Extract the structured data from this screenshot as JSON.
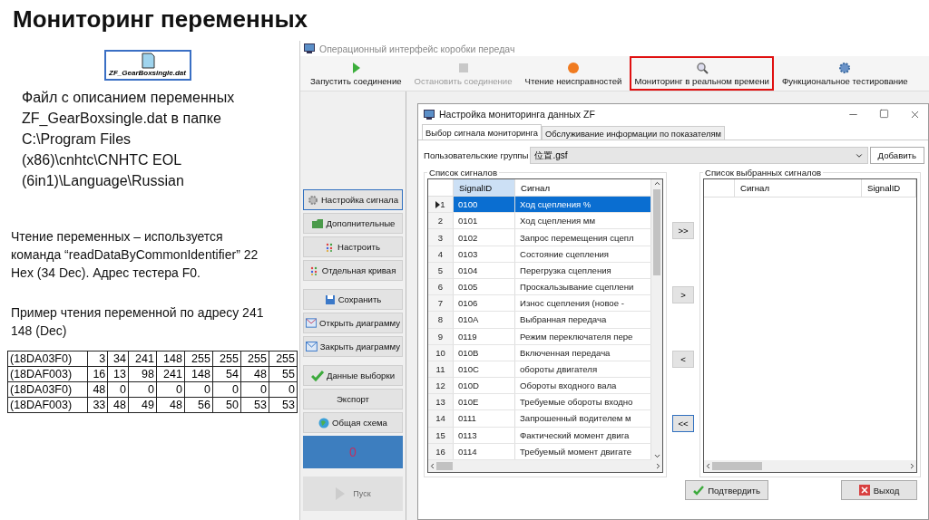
{
  "slide_title": "Мониторинг переменных",
  "file_icon": {
    "label": "ZF_GearBoxsingle.dat"
  },
  "notes": [
    {
      "kind": "large",
      "text": "Файл с описанием переменных ZF_GearBoxsingle.dat в папке C:\\Program Files (x86)\\cnhtc\\CNHTC EOL (6in1)\\Language\\Russian"
    },
    {
      "kind": "small",
      "text": "Чтение переменных – используется команда “readDataByCommonIdentifier” 22 Hex (34 Dec). Адрес тестера F0."
    },
    {
      "kind": "small",
      "text": "Пример чтения переменной по адресу 241 148 (Dec)"
    }
  ],
  "data_table": [
    [
      "(18DA03F0)",
      "3",
      "34",
      "241",
      "148",
      "255",
      "255",
      "255",
      "255"
    ],
    [
      "(18DAF003)",
      "16",
      "13",
      "98",
      "241",
      "148",
      "54",
      "48",
      "55"
    ],
    [
      "(18DA03F0)",
      "48",
      "0",
      "0",
      "0",
      "0",
      "0",
      "0",
      "0"
    ],
    [
      "(18DAF003)",
      "33",
      "48",
      "49",
      "48",
      "56",
      "50",
      "53",
      "53"
    ]
  ],
  "app": {
    "title": "Операционный интерфейс коробки передач",
    "toolbar": [
      {
        "label": "Запустить соединение",
        "disabled": false,
        "highlighted": false
      },
      {
        "label": "Остановить соединение",
        "disabled": true,
        "highlighted": false
      },
      {
        "label": "Чтение неисправностей",
        "disabled": false,
        "highlighted": false
      },
      {
        "label": "Мониторинг в реальном времени",
        "disabled": false,
        "highlighted": true
      },
      {
        "label": "Функциональное тестирование",
        "disabled": false,
        "highlighted": false
      }
    ],
    "side_groups": [
      [
        {
          "label": "Настройка сигнала",
          "focused": true
        },
        {
          "label": "Дополнительные",
          "focused": false
        },
        {
          "label": "Настроить",
          "focused": false
        },
        {
          "label": "Отдельная кривая",
          "focused": false
        }
      ],
      [
        {
          "label": "Сохранить",
          "focused": false
        },
        {
          "label": "Открыть диаграмму",
          "focused": false
        },
        {
          "label": "Закрыть диаграмму",
          "focused": false
        }
      ],
      [
        {
          "label": "Данные выборки",
          "focused": false
        },
        {
          "label": "Экспорт",
          "focused": false
        },
        {
          "label": "Общая схема",
          "focused": false
        }
      ]
    ],
    "counter": "0",
    "run_button": {
      "label": "Пуск",
      "disabled": true
    }
  },
  "dialog": {
    "title": "Настройка мониторинга данных ZF",
    "tabs": [
      {
        "label": "Выбор сигнала мониторинга",
        "selected": true
      },
      {
        "label": "Обслуживание информации по показателям",
        "selected": false
      }
    ],
    "group_label": "Пользовательские группы",
    "group_value": "位置.gsf",
    "add_button": "Добавить",
    "signal_list": {
      "title": "Список сигналов",
      "columns": [
        "SignalID",
        "Сигнал"
      ],
      "rows": [
        {
          "num": "1",
          "id": "0100",
          "signal": "Ход сцепления %",
          "selected": true
        },
        {
          "num": "2",
          "id": "0101",
          "signal": "Ход сцепления мм",
          "selected": false
        },
        {
          "num": "3",
          "id": "0102",
          "signal": "Запрос перемещения сцепл",
          "selected": false
        },
        {
          "num": "4",
          "id": "0103",
          "signal": "Состояние сцепления",
          "selected": false
        },
        {
          "num": "5",
          "id": "0104",
          "signal": "Перегрузка сцепления",
          "selected": false
        },
        {
          "num": "6",
          "id": "0105",
          "signal": "Проскальзывание сцеплени",
          "selected": false
        },
        {
          "num": "7",
          "id": "0106",
          "signal": "Износ сцепления (новое -",
          "selected": false
        },
        {
          "num": "8",
          "id": "010A",
          "signal": "Выбранная передача",
          "selected": false
        },
        {
          "num": "9",
          "id": "0119",
          "signal": "Режим переключателя пере",
          "selected": false
        },
        {
          "num": "10",
          "id": "010B",
          "signal": "Включенная передача",
          "selected": false
        },
        {
          "num": "11",
          "id": "010C",
          "signal": "обороты двигателя",
          "selected": false
        },
        {
          "num": "12",
          "id": "010D",
          "signal": "Обороты входного вала",
          "selected": false
        },
        {
          "num": "13",
          "id": "010E",
          "signal": "Требуемые обороты входно",
          "selected": false
        },
        {
          "num": "14",
          "id": "0111",
          "signal": "Запрошенный водителем м",
          "selected": false
        },
        {
          "num": "15",
          "id": "0113",
          "signal": "Фактический момент двига",
          "selected": false
        },
        {
          "num": "16",
          "id": "0114",
          "signal": "Требуемый момент двигате",
          "selected": false
        }
      ]
    },
    "move_buttons": [
      {
        "label": ">>",
        "focused": false
      },
      {
        "label": ">",
        "focused": false
      },
      {
        "label": "<",
        "focused": false
      },
      {
        "label": "<<",
        "focused": true
      }
    ],
    "selected_list": {
      "title": "Список выбранных сигналов",
      "columns": [
        "Сигнал",
        "SignalID"
      ]
    },
    "confirm_button": "Подтвердить",
    "exit_button": "Выход"
  }
}
